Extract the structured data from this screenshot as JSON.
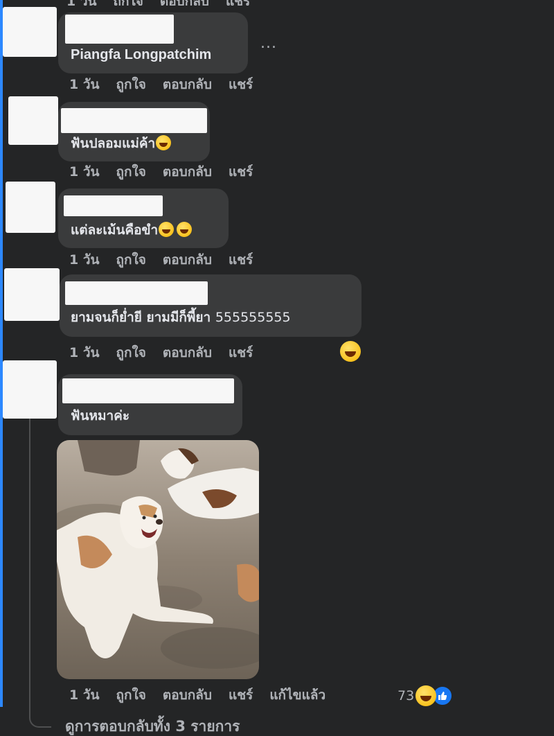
{
  "actions": {
    "time": "1 วัน",
    "like": "ถูกใจ",
    "reply": "ตอบกลับ",
    "share": "แชร์",
    "edited": "แก้ไขแล้ว"
  },
  "comments": [
    {
      "text": "Piangfa Longpatchim"
    },
    {
      "text": "ฟันปลอมแม่ค้า",
      "emoji": "rolling-on-floor-laughing"
    },
    {
      "text": "แต่ละเม้นคือขำ",
      "emoji": "tears-of-joy"
    },
    {
      "text": "ยามจนก็ย่ำยี ยามมีก็พี้ยา",
      "suffix": "555555555",
      "emoji": "grinning-squinting"
    },
    {
      "text": "ฟันหมาค่ะ",
      "reaction_count": "73",
      "reactions": [
        "grinning-squinting",
        "like"
      ]
    }
  ],
  "view_replies": "ดูการตอบกลับทั้ง 3 รายการ",
  "more_options": "...",
  "colors": {
    "background": "#242526",
    "bubble": "#3a3b3c",
    "text": "#e4e6eb",
    "secondary_text": "#b0b3b8",
    "like_blue": "#1877f2"
  }
}
